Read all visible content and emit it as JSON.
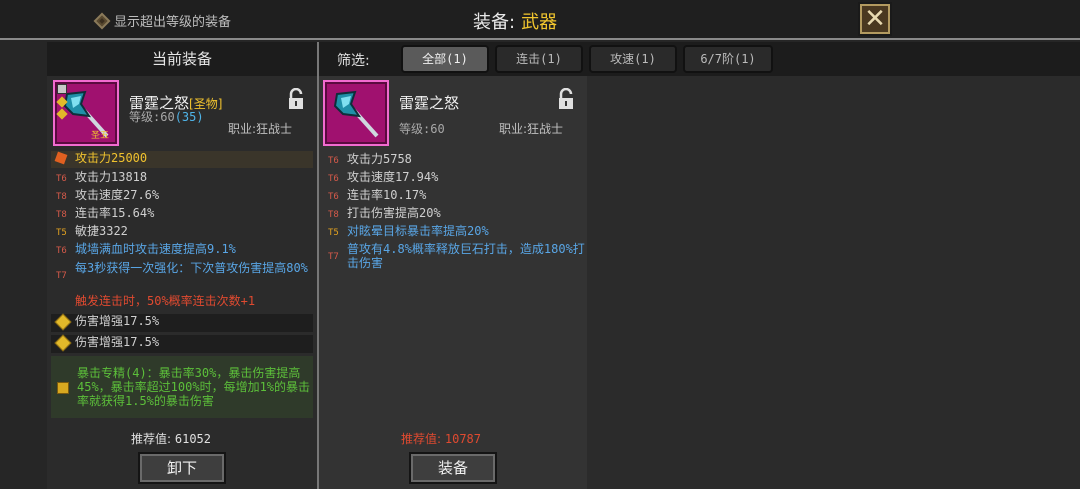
{
  "header": {
    "toggle_label": "显示超出等级的装备",
    "title_label": "装备:",
    "title_value": "武器"
  },
  "current": {
    "panel_title": "当前装备",
    "item_name": "雷霆之怒",
    "item_tag": "[圣物]",
    "icon_badge": "圣五",
    "level_prefix": "等级:",
    "level_value": "60",
    "level_extra": "(35)",
    "class_label": "职业:狂战士",
    "stats": [
      {
        "tier": "",
        "text": "攻击力25000"
      },
      {
        "tier": "T6",
        "text": "攻击力13818"
      },
      {
        "tier": "T8",
        "text": "攻击速度27.6%"
      },
      {
        "tier": "T8",
        "text": "连击率15.64%"
      },
      {
        "tier": "T5",
        "text": "敏捷3322"
      },
      {
        "tier": "T6",
        "text": "城墙满血时攻击速度提高9.1%"
      },
      {
        "tier": "T7",
        "text": "每3秒获得一次强化：下次普攻伤害提高80%"
      },
      {
        "tier": "",
        "text": "触发连击时，50%概率连击次数+1"
      }
    ],
    "gems": [
      "伤害增强17.5%",
      "伤害增强17.5%"
    ],
    "set_bonus": "暴击专精(4)：暴击率30%，暴击伤害提高45%，暴击率超过100%时，每增加1%的暴击率就获得1.5%的暴击伤害",
    "rec_label": "推荐值:",
    "rec_value": "61052",
    "action_label": "卸下"
  },
  "filter": {
    "label": "筛选:",
    "tabs": [
      {
        "label": "全部(1)",
        "active": true
      },
      {
        "label": "连击(1)",
        "active": false
      },
      {
        "label": "攻速(1)",
        "active": false
      },
      {
        "label": "6/7阶(1)",
        "active": false
      }
    ]
  },
  "candidate": {
    "item_name": "雷霆之怒",
    "level_label": "等级:60",
    "class_label": "职业:狂战士",
    "stats": [
      {
        "tier": "T6",
        "text": "攻击力5758"
      },
      {
        "tier": "T6",
        "text": "攻击速度17.94%"
      },
      {
        "tier": "T6",
        "text": "连击率10.17%"
      },
      {
        "tier": "T8",
        "text": "打击伤害提高20%"
      },
      {
        "tier": "T5",
        "text": "对眩晕目标暴击率提高20%"
      },
      {
        "tier": "T7",
        "text": "普攻有4.8%概率释放巨石打击，造成180%打击伤害"
      }
    ],
    "rec_label": "推荐值:",
    "rec_value": "10787",
    "action_label": "装备"
  },
  "colors": {
    "gold": "#f0c22e",
    "blue": "#59a6e6",
    "red": "#e04a30",
    "green": "#5cbf3a",
    "item_bg": "#a0116f"
  },
  "icons": [
    "diamond-toggle-icon",
    "close-icon",
    "axe-icon",
    "lock-open-icon",
    "gem-icon",
    "book-icon"
  ]
}
